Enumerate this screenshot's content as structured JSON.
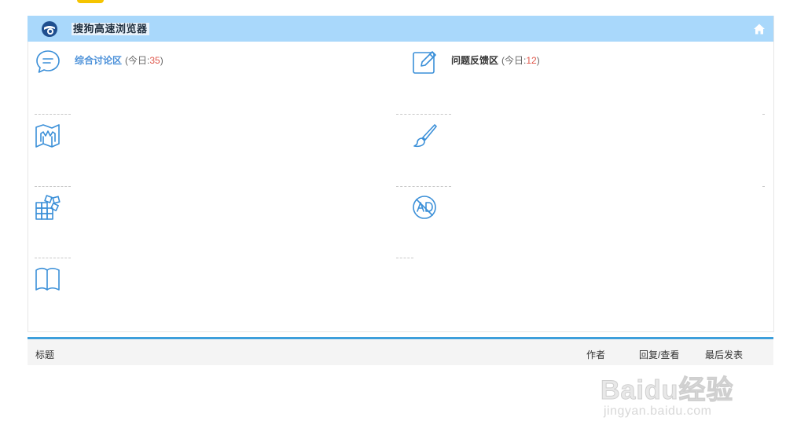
{
  "header": {
    "title": "搜狗高速浏览器",
    "logo_icon": "sogou-browser-logo-icon",
    "home_icon": "home-icon"
  },
  "forums": [
    {
      "name": "综合讨论区",
      "today_label": "(今日:",
      "today_count": "35",
      "today_close": ")",
      "icon": "chat-bubble-icon",
      "name_color": "#4a90d9"
    },
    {
      "name": "问题反馈区",
      "today_label": "(今日:",
      "today_count": "12",
      "today_close": ")",
      "icon": "edit-icon",
      "name_color": "#333333"
    },
    {
      "name": "",
      "icon": "map-icon"
    },
    {
      "name": "",
      "icon": "brush-icon"
    },
    {
      "name": "",
      "icon": "apps-icon"
    },
    {
      "name": "",
      "icon": "ad-block-icon"
    },
    {
      "name": "",
      "icon": "book-icon"
    }
  ],
  "table": {
    "col_title": "标题",
    "col_author": "作者",
    "col_replies_views": "回复/查看",
    "col_last_post": "最后发表"
  },
  "watermark": {
    "brand": "Baidu经验",
    "url": "jingyan.baidu.com"
  },
  "colors": {
    "header_bg": "#a9d8fb",
    "accent": "#3d9fdb",
    "icon": "#3a8fd8",
    "count": "#e0584c"
  }
}
